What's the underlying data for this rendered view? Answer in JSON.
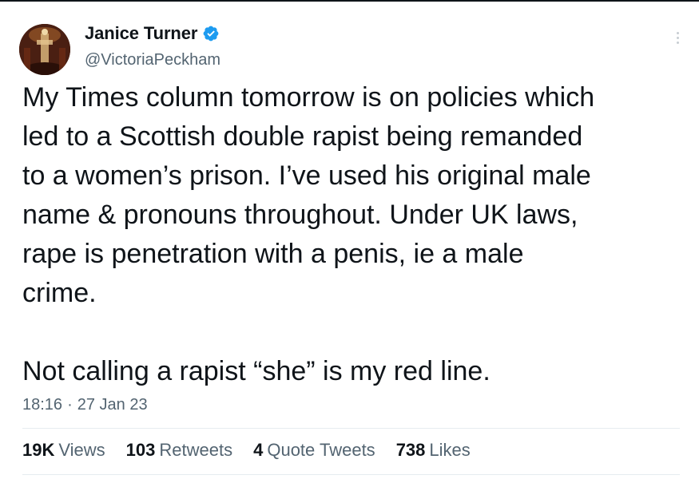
{
  "author": {
    "display_name": "Janice Turner",
    "handle": "@VictoriaPeckham",
    "verified": true
  },
  "tweet": {
    "text": "My Times column tomorrow is on policies which\nled to a Scottish double rapist being remanded\nto a women’s prison. I’ve used his original male\nname & pronouns throughout. Under UK laws,\nrape is penetration with a penis, ie a male\ncrime.\n\nNot calling a rapist “she” is my red line.",
    "time": "18:16",
    "separator": "·",
    "date": "27 Jan 23"
  },
  "stats": [
    {
      "count": "19K",
      "label": "Views"
    },
    {
      "count": "103",
      "label": "Retweets"
    },
    {
      "count": "4",
      "label": "Quote Tweets"
    },
    {
      "count": "738",
      "label": "Likes"
    }
  ],
  "colors": {
    "text_primary": "#0f1419",
    "text_secondary": "#536471",
    "verified_blue": "#1d9bf0",
    "divider": "#e6ecf0"
  },
  "icons": {
    "verified": "verified-badge-icon",
    "more": "more-vertical-icon"
  }
}
